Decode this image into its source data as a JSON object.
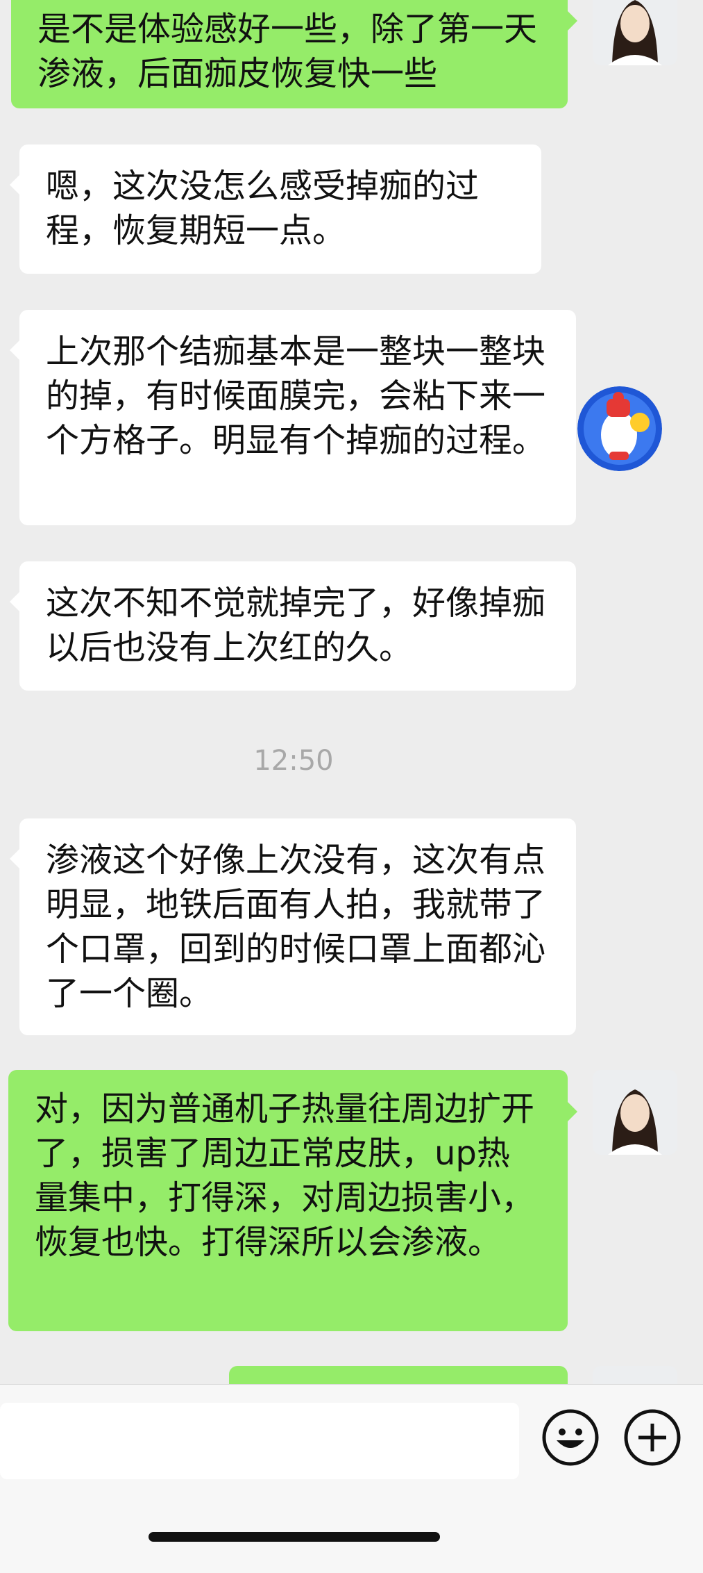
{
  "conversation": {
    "messages": [
      {
        "id": "m1",
        "direction": "outgoing",
        "text": "是不是体验感好一些，除了第一天渗液，后面痂皮恢复快一些"
      },
      {
        "id": "m2",
        "direction": "incoming",
        "text": "嗯，这次没怎么感受掉痂的过程，恢复期短一点。"
      },
      {
        "id": "m3",
        "direction": "incoming",
        "text": "上次那个结痂基本是一整块一整块的掉，有时候面膜完，会粘下来一个方格子。明显有个掉痂的过程。"
      },
      {
        "id": "m4",
        "direction": "incoming",
        "text": "这次不知不觉就掉完了，好像掉痂以后也没有上次红的久。"
      },
      {
        "id": "m5",
        "direction": "incoming",
        "text": "渗液这个好像上次没有，这次有点明显，地铁后面有人拍，我就带了个口罩，回到的时候口罩上面都沁了一个圈。"
      },
      {
        "id": "m6",
        "direction": "outgoing",
        "text": "对，因为普通机子热量往周边扩开了，损害了周边正常皮肤，up热量集中，打得深，对周边损害小，恢复也快。打得深所以会渗液。"
      },
      {
        "id": "m7",
        "direction": "outgoing",
        "text": ""
      }
    ],
    "timestamp": "12:50"
  },
  "composer": {
    "input_value": "",
    "emoji_icon": "emoji-smile-icon",
    "plus_icon": "plus-circle-icon"
  },
  "colors": {
    "background": "#ededed",
    "outgoing_bubble": "#95ec69",
    "incoming_bubble": "#ffffff",
    "timestamp_text": "#a8a8a8"
  }
}
